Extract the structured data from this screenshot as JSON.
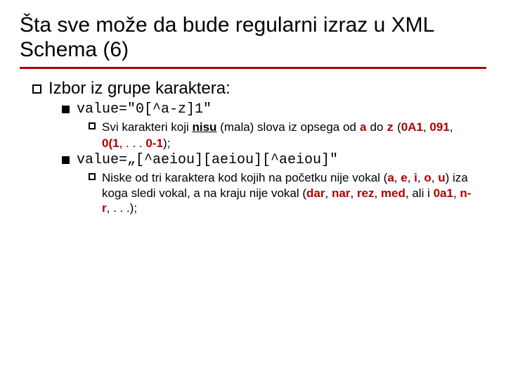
{
  "title": "Šta sve može da bude regularni izraz u XML Schema (6)",
  "l1": "Izbor iz grupe karaktera:",
  "v1": "value=\"0[^a-z]1\"",
  "v1_desc": {
    "pre": "Svi karakteri koji ",
    "nisu": "nisu",
    "mid1": " (mala) slova iz opsega od ",
    "a": "a",
    "mid2": " do ",
    "z": "z",
    "open": " (",
    "ex1": "0A1",
    "c1": ", ",
    "ex2": "091",
    "c2": ", ",
    "ex3": "0(1",
    "c3": ", . . . ",
    "ex4": "0-1",
    "close": ");"
  },
  "v2": "value=„[^aeiou][aeiou][^aeiou]\"",
  "v2_desc": {
    "pre": "Niske od tri karaktera kod kojih na početku nije vokal (",
    "a": "a",
    "c1": ", ",
    "e": "e",
    "c2": ", ",
    "i": "i",
    "c3": ", ",
    "o": "o",
    "c4": ", ",
    "u": "u",
    "mid": ") iza koga sledi vokal, a na kraju nije vokal (",
    "ex1": "dar",
    "d1": ", ",
    "ex2": "nar",
    "d2": ", ",
    "ex3": "rez",
    "d3": ", ",
    "ex4": "med",
    "d4": ", ali i ",
    "ex5": "0a1",
    "d5": ", ",
    "ex6": "n-r",
    "close": ", . . .);"
  }
}
